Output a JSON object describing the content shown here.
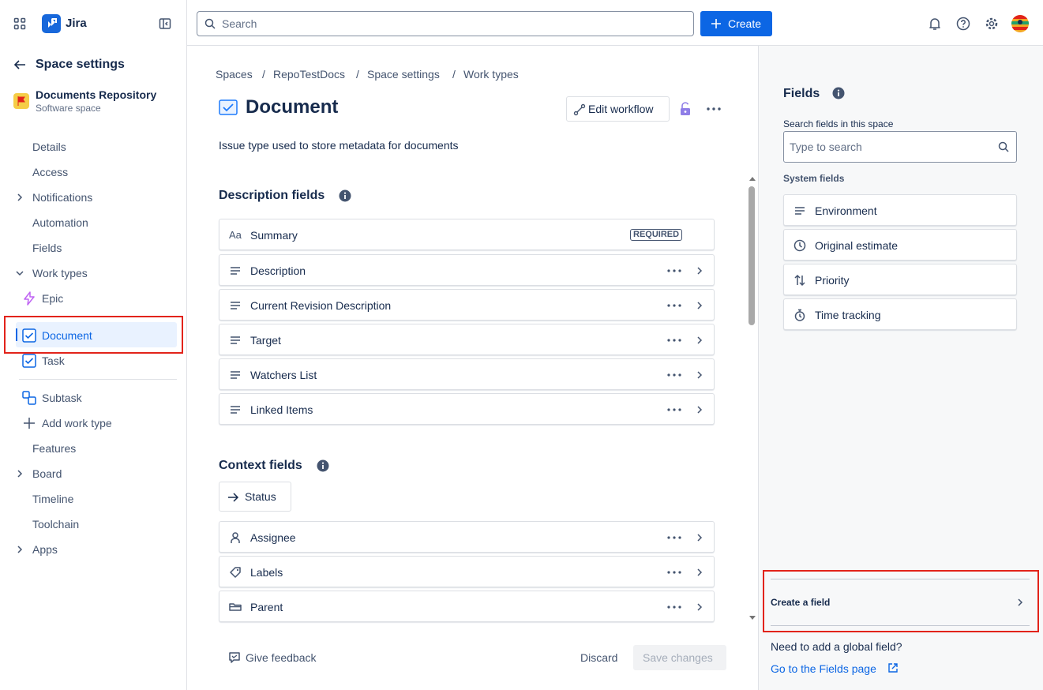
{
  "app": {
    "name": "Jira"
  },
  "top": {
    "search_placeholder": "Search",
    "create_label": "Create",
    "icons": [
      "bell-icon",
      "help-icon",
      "settings-icon",
      "avatar"
    ]
  },
  "sidebar": {
    "back_title": "Space settings",
    "space_name": "Documents Repository",
    "space_type": "Software space",
    "items": {
      "details": "Details",
      "access": "Access",
      "notifications": "Notifications",
      "automation": "Automation",
      "fields": "Fields",
      "work_types": "Work types",
      "features": "Features",
      "board": "Board",
      "timeline": "Timeline",
      "toolchain": "Toolchain",
      "apps": "Apps"
    },
    "work_types": {
      "epic": "Epic",
      "document": "Document",
      "task": "Task",
      "subtask": "Subtask",
      "add": "Add work type"
    }
  },
  "breadcrumb": [
    "Spaces",
    "RepoTestDocs",
    "Space settings",
    "Work types"
  ],
  "main": {
    "title": "Document",
    "description": "Issue type used to store metadata for documents",
    "edit_workflow": "Edit workflow",
    "description_fields_title": "Description fields",
    "required_badge": "REQUIRED",
    "description_fields": [
      {
        "label": "Summary"
      },
      {
        "label": "Description"
      },
      {
        "label": "Current Revision Description"
      },
      {
        "label": "Target"
      },
      {
        "label": "Watchers List"
      },
      {
        "label": "Linked Items"
      }
    ],
    "context_fields_title": "Context fields",
    "status_label": "Status",
    "context_fields": [
      {
        "label": "Assignee"
      },
      {
        "label": "Labels"
      },
      {
        "label": "Parent"
      }
    ],
    "give_feedback": "Give feedback",
    "discard": "Discard",
    "save_changes": "Save changes"
  },
  "right_panel": {
    "title": "Fields",
    "search_label": "Search fields in this space",
    "search_placeholder": "Type to search",
    "system_fields_title": "System fields",
    "system_fields": [
      {
        "label": "Environment"
      },
      {
        "label": "Original estimate"
      },
      {
        "label": "Priority"
      },
      {
        "label": "Time tracking"
      }
    ],
    "create_field": "Create a field",
    "global_prompt": "Need to add a global field?",
    "fields_page_link": "Go to the Fields page"
  },
  "colors": {
    "brand_blue": "#0c66e4",
    "text": "#172b4d",
    "subtle_text": "#44546f",
    "highlight_red": "#e2231a",
    "selected_bg": "#e9f2ff",
    "epic_purple": "#bf63f3"
  }
}
